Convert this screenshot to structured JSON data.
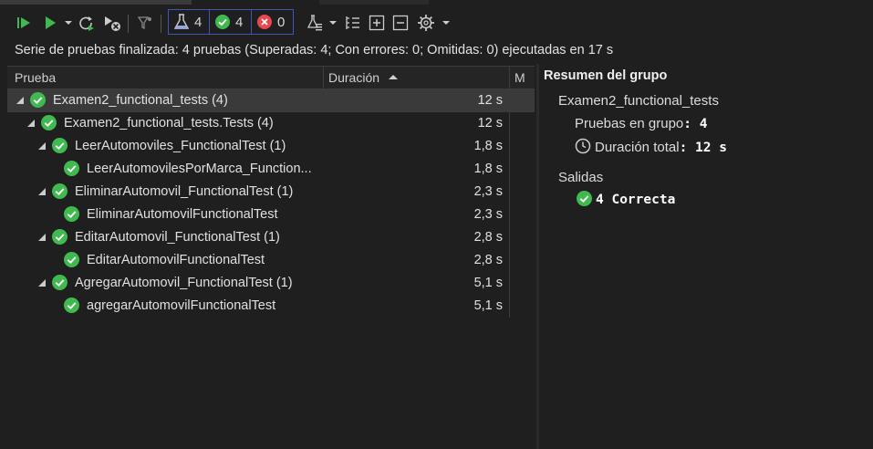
{
  "toolbar": {
    "counters": {
      "total": "4",
      "passed": "4",
      "failed": "0"
    }
  },
  "status": {
    "summary": "Serie de pruebas finalizada: 4 pruebas (Superadas: 4; Con errores: 0; Omitidas: 0) ejecutadas en 17 s"
  },
  "grid": {
    "headers": {
      "test": "Prueba",
      "duration": "Duración",
      "m": "M"
    },
    "rows": [
      {
        "label": "Examen2_functional_tests  (4)",
        "duration": "12 s"
      },
      {
        "label": "Examen2_functional_tests.Tests  (4)",
        "duration": "12 s"
      },
      {
        "label": "LeerAutomoviles_FunctionalTest  (1)",
        "duration": "1,8 s"
      },
      {
        "label": "LeerAutomovilesPorMarca_Function...",
        "duration": "1,8 s"
      },
      {
        "label": "EliminarAutomovil_FunctionalTest  (1)",
        "duration": "2,3 s"
      },
      {
        "label": "EliminarAutomovilFunctionalTest",
        "duration": "2,3 s"
      },
      {
        "label": "EditarAutomovil_FunctionalTest  (1)",
        "duration": "2,8 s"
      },
      {
        "label": "EditarAutomovilFunctionalTest",
        "duration": "2,8 s"
      },
      {
        "label": "AgregarAutomovil_FunctionalTest  (1)",
        "duration": "5,1 s"
      },
      {
        "label": "agregarAutomovilFunctionalTest",
        "duration": "5,1 s"
      }
    ]
  },
  "summary_panel": {
    "title": "Resumen del grupo",
    "group_name": "Examen2_functional_tests",
    "tests_in_group_label": "Pruebas en grupo",
    "tests_in_group_value": "4",
    "total_duration_label": "Duración total",
    "total_duration_value": "12 s",
    "outputs_label": "Salidas",
    "outputs_count": "4",
    "outputs_status": "Correcta"
  },
  "colors": {
    "pass_green": "#3fb950",
    "fail_red": "#e5484d",
    "accent_blue": "#3d56b8",
    "play_green": "#3fb950"
  }
}
